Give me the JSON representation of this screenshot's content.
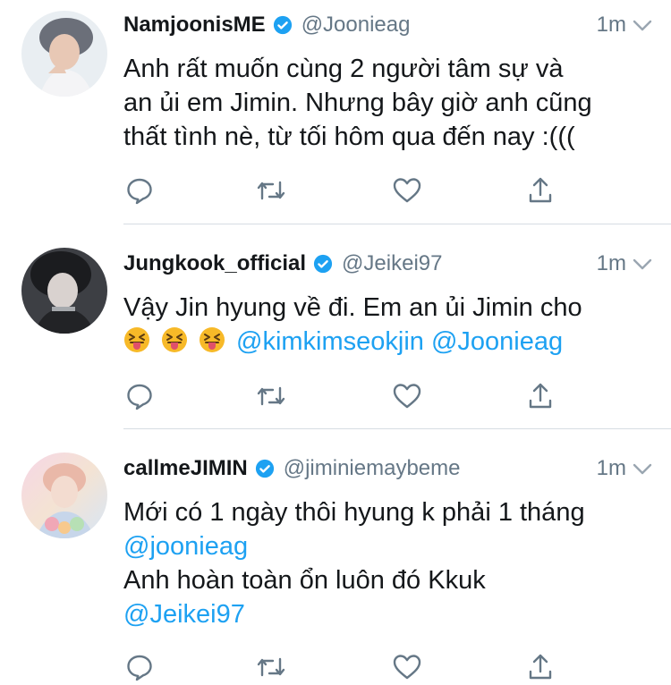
{
  "tweets": [
    {
      "name": "NamjoonisME",
      "handle": "@Joonieag",
      "time": "1m",
      "lines": [
        "Anh rất muốn cùng 2 người tâm sự và",
        "an ủi em Jimin. Nhưng bây giờ anh cũng",
        "thất tình nè, từ tối hôm qua đến nay :((("
      ]
    },
    {
      "name": "Jungkook_official",
      "handle": "@Jeikei97",
      "time": "1m",
      "line1": "Vậy Jin hyung về đi. Em an ủi Jimin cho",
      "emoji_icon": "squinting-face-with-tongue-icon",
      "mentions": [
        "@kimkimseokjin",
        "@Joonieag"
      ]
    },
    {
      "name": "callmeJIMIN",
      "handle": "@jiminiemaybeme",
      "time": "1m",
      "line1": "Mới có 1 ngày thôi hyung k phải 1 tháng",
      "mention1": "@joonieag",
      "line3": "Anh hoàn toàn ổn luôn đó Kkuk",
      "mention2": "@Jeikei97"
    }
  ],
  "colors": {
    "accent": "#1da1f2",
    "secondary_text": "#657786",
    "icon": "#657786",
    "divider": "#d6dde3"
  },
  "action_icons": [
    "reply-icon",
    "retweet-icon",
    "like-icon",
    "share-icon"
  ]
}
